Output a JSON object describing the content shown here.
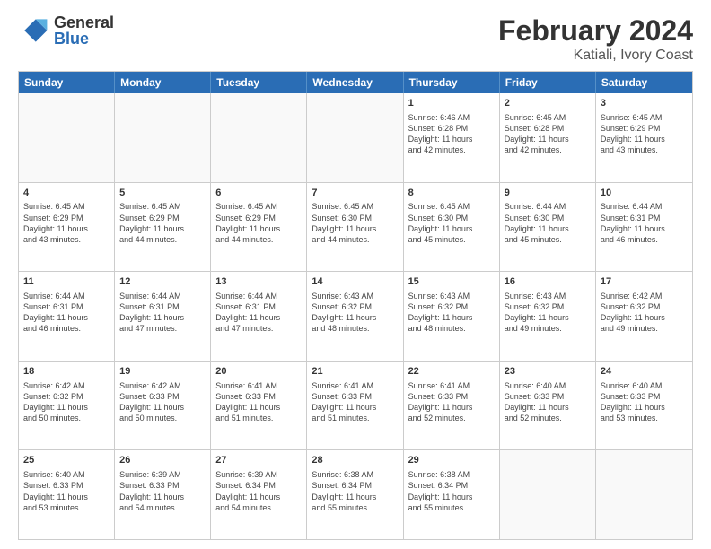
{
  "header": {
    "logo": {
      "general": "General",
      "blue": "Blue"
    },
    "title": "February 2024",
    "subtitle": "Katiali, Ivory Coast"
  },
  "weekdays": [
    "Sunday",
    "Monday",
    "Tuesday",
    "Wednesday",
    "Thursday",
    "Friday",
    "Saturday"
  ],
  "rows": [
    [
      {
        "day": "",
        "info": ""
      },
      {
        "day": "",
        "info": ""
      },
      {
        "day": "",
        "info": ""
      },
      {
        "day": "",
        "info": ""
      },
      {
        "day": "1",
        "info": "Sunrise: 6:46 AM\nSunset: 6:28 PM\nDaylight: 11 hours\nand 42 minutes."
      },
      {
        "day": "2",
        "info": "Sunrise: 6:45 AM\nSunset: 6:28 PM\nDaylight: 11 hours\nand 42 minutes."
      },
      {
        "day": "3",
        "info": "Sunrise: 6:45 AM\nSunset: 6:29 PM\nDaylight: 11 hours\nand 43 minutes."
      }
    ],
    [
      {
        "day": "4",
        "info": "Sunrise: 6:45 AM\nSunset: 6:29 PM\nDaylight: 11 hours\nand 43 minutes."
      },
      {
        "day": "5",
        "info": "Sunrise: 6:45 AM\nSunset: 6:29 PM\nDaylight: 11 hours\nand 44 minutes."
      },
      {
        "day": "6",
        "info": "Sunrise: 6:45 AM\nSunset: 6:29 PM\nDaylight: 11 hours\nand 44 minutes."
      },
      {
        "day": "7",
        "info": "Sunrise: 6:45 AM\nSunset: 6:30 PM\nDaylight: 11 hours\nand 44 minutes."
      },
      {
        "day": "8",
        "info": "Sunrise: 6:45 AM\nSunset: 6:30 PM\nDaylight: 11 hours\nand 45 minutes."
      },
      {
        "day": "9",
        "info": "Sunrise: 6:44 AM\nSunset: 6:30 PM\nDaylight: 11 hours\nand 45 minutes."
      },
      {
        "day": "10",
        "info": "Sunrise: 6:44 AM\nSunset: 6:31 PM\nDaylight: 11 hours\nand 46 minutes."
      }
    ],
    [
      {
        "day": "11",
        "info": "Sunrise: 6:44 AM\nSunset: 6:31 PM\nDaylight: 11 hours\nand 46 minutes."
      },
      {
        "day": "12",
        "info": "Sunrise: 6:44 AM\nSunset: 6:31 PM\nDaylight: 11 hours\nand 47 minutes."
      },
      {
        "day": "13",
        "info": "Sunrise: 6:44 AM\nSunset: 6:31 PM\nDaylight: 11 hours\nand 47 minutes."
      },
      {
        "day": "14",
        "info": "Sunrise: 6:43 AM\nSunset: 6:32 PM\nDaylight: 11 hours\nand 48 minutes."
      },
      {
        "day": "15",
        "info": "Sunrise: 6:43 AM\nSunset: 6:32 PM\nDaylight: 11 hours\nand 48 minutes."
      },
      {
        "day": "16",
        "info": "Sunrise: 6:43 AM\nSunset: 6:32 PM\nDaylight: 11 hours\nand 49 minutes."
      },
      {
        "day": "17",
        "info": "Sunrise: 6:42 AM\nSunset: 6:32 PM\nDaylight: 11 hours\nand 49 minutes."
      }
    ],
    [
      {
        "day": "18",
        "info": "Sunrise: 6:42 AM\nSunset: 6:32 PM\nDaylight: 11 hours\nand 50 minutes."
      },
      {
        "day": "19",
        "info": "Sunrise: 6:42 AM\nSunset: 6:33 PM\nDaylight: 11 hours\nand 50 minutes."
      },
      {
        "day": "20",
        "info": "Sunrise: 6:41 AM\nSunset: 6:33 PM\nDaylight: 11 hours\nand 51 minutes."
      },
      {
        "day": "21",
        "info": "Sunrise: 6:41 AM\nSunset: 6:33 PM\nDaylight: 11 hours\nand 51 minutes."
      },
      {
        "day": "22",
        "info": "Sunrise: 6:41 AM\nSunset: 6:33 PM\nDaylight: 11 hours\nand 52 minutes."
      },
      {
        "day": "23",
        "info": "Sunrise: 6:40 AM\nSunset: 6:33 PM\nDaylight: 11 hours\nand 52 minutes."
      },
      {
        "day": "24",
        "info": "Sunrise: 6:40 AM\nSunset: 6:33 PM\nDaylight: 11 hours\nand 53 minutes."
      }
    ],
    [
      {
        "day": "25",
        "info": "Sunrise: 6:40 AM\nSunset: 6:33 PM\nDaylight: 11 hours\nand 53 minutes."
      },
      {
        "day": "26",
        "info": "Sunrise: 6:39 AM\nSunset: 6:33 PM\nDaylight: 11 hours\nand 54 minutes."
      },
      {
        "day": "27",
        "info": "Sunrise: 6:39 AM\nSunset: 6:34 PM\nDaylight: 11 hours\nand 54 minutes."
      },
      {
        "day": "28",
        "info": "Sunrise: 6:38 AM\nSunset: 6:34 PM\nDaylight: 11 hours\nand 55 minutes."
      },
      {
        "day": "29",
        "info": "Sunrise: 6:38 AM\nSunset: 6:34 PM\nDaylight: 11 hours\nand 55 minutes."
      },
      {
        "day": "",
        "info": ""
      },
      {
        "day": "",
        "info": ""
      }
    ]
  ]
}
